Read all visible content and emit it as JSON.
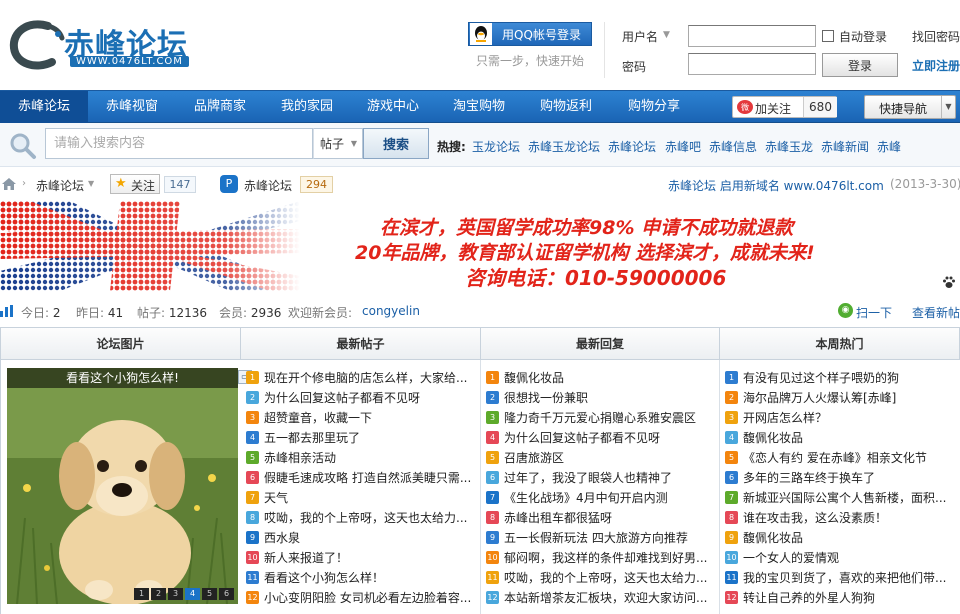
{
  "header": {
    "logo_title": "赤峰论坛",
    "logo_url": "WWW.0476LT.COM",
    "qq_login": "用QQ帐号登录",
    "qq_hint": "只需一步，快速开始",
    "username_label": "用户名",
    "password_label": "密码",
    "auto_login": "自动登录",
    "login_button": "登录",
    "find_password": "找回密码",
    "register": "立即注册"
  },
  "nav": {
    "items": [
      "赤峰论坛",
      "赤峰视窗",
      "品牌商家",
      "我的家园",
      "游戏中心",
      "淘宝购物",
      "购物返利",
      "购物分享"
    ],
    "active_index": 0,
    "follow_label": "加关注",
    "follow_count": "680",
    "quick_nav": "快捷导航"
  },
  "search": {
    "placeholder": "请输入搜索内容",
    "type": "帖子",
    "button": "搜索",
    "hot_label": "热搜:",
    "hot_terms": [
      "玉龙论坛",
      "赤峰玉龙论坛",
      "赤峰论坛",
      "赤峰吧",
      "赤峰信息",
      "赤峰玉龙",
      "赤峰新闻",
      "赤峰"
    ]
  },
  "breadcrumb": {
    "forum": "赤峰论坛",
    "star_label": "关注",
    "star_count": "147",
    "app_label": "赤峰论坛",
    "app_count": "294",
    "notice": "赤峰论坛 启用新域名 www.0476lt.com",
    "notice_date": "(2013-3-30)"
  },
  "banner": {
    "line1": "在滨才，英国留学成功率98%  申请不成功就退款",
    "line2": "20年品牌，教育部认证留学机构 选择滨才，成就未来!",
    "line3": "咨询电话：010-59000006",
    "colors": {
      "red": "#e2241a",
      "blue": "#1b4f9c"
    }
  },
  "stats": {
    "today_label": "今日:",
    "today": "2",
    "yesterday_label": "昨日:",
    "yesterday": "41",
    "posts_label": "帖子:",
    "posts": "12136",
    "members_label": "会员:",
    "members": "2936",
    "welcome_label": "欢迎新会员:",
    "new_member": "congyelin",
    "scan": "扫一下",
    "view_new": "查看新帖"
  },
  "grid": {
    "headers": [
      "论坛图片",
      "最新帖子",
      "最新回复",
      "本周热门"
    ],
    "photo_title": "看看这个小狗怎么样!",
    "photo_pages": [
      "1",
      "2",
      "3",
      "4",
      "5",
      "6"
    ],
    "photo_active_page": 3,
    "latest_posts": [
      "现在开个修电脑的店怎么样，大家给...",
      "为什么回复这帖子都看不见呀",
      "超赞童音，收藏一下",
      "五一都去那里玩了",
      "赤峰相亲活动",
      "假睫毛速成攻略 打造自然派美睫只需...",
      "天气",
      "哎呦，我的个上帝呀，这天也太给力...",
      "西水泉",
      "新人来报道了！",
      "看看这个小狗怎么样！",
      "小心变阴阳脸 女司机必看左边脸着容..."
    ],
    "latest_replies": [
      "馥佩化妆品",
      "很想找一份兼职",
      "隆力奇千万元爱心捐赠心系雅安震区",
      "为什么回复这帖子都看不见呀",
      "召唐旅游区",
      "过年了，我没了眼袋人也精神了",
      "《生化战场》4月中旬开启内测",
      "赤峰出租车都很猛呀",
      "五一长假新玩法 四大旅游方向推荐",
      "郁闷啊，我这样的条件却难找到好男...",
      "哎呦，我的个上帝呀，这天也太给力...",
      "本站新增茶友汇板块，欢迎大家访问..."
    ],
    "weekly_hot": [
      "有没有见过这个样子喂奶的狗",
      "海尔品牌万人火爆认筹[赤峰]",
      "开网店怎么样？",
      "馥佩化妆品",
      "《恋人有约 爱在赤峰》相亲文化节",
      "多年的三路车终于换车了",
      "新城亚兴国际公寓个人售新楼，面积...",
      "谁在攻击我，这么没素质！",
      "馥佩化妆品",
      "一个女人的爱情观",
      "我的宝贝到货了，喜欢的来把他们带...",
      "转让自己养的外星人狗狗"
    ]
  }
}
